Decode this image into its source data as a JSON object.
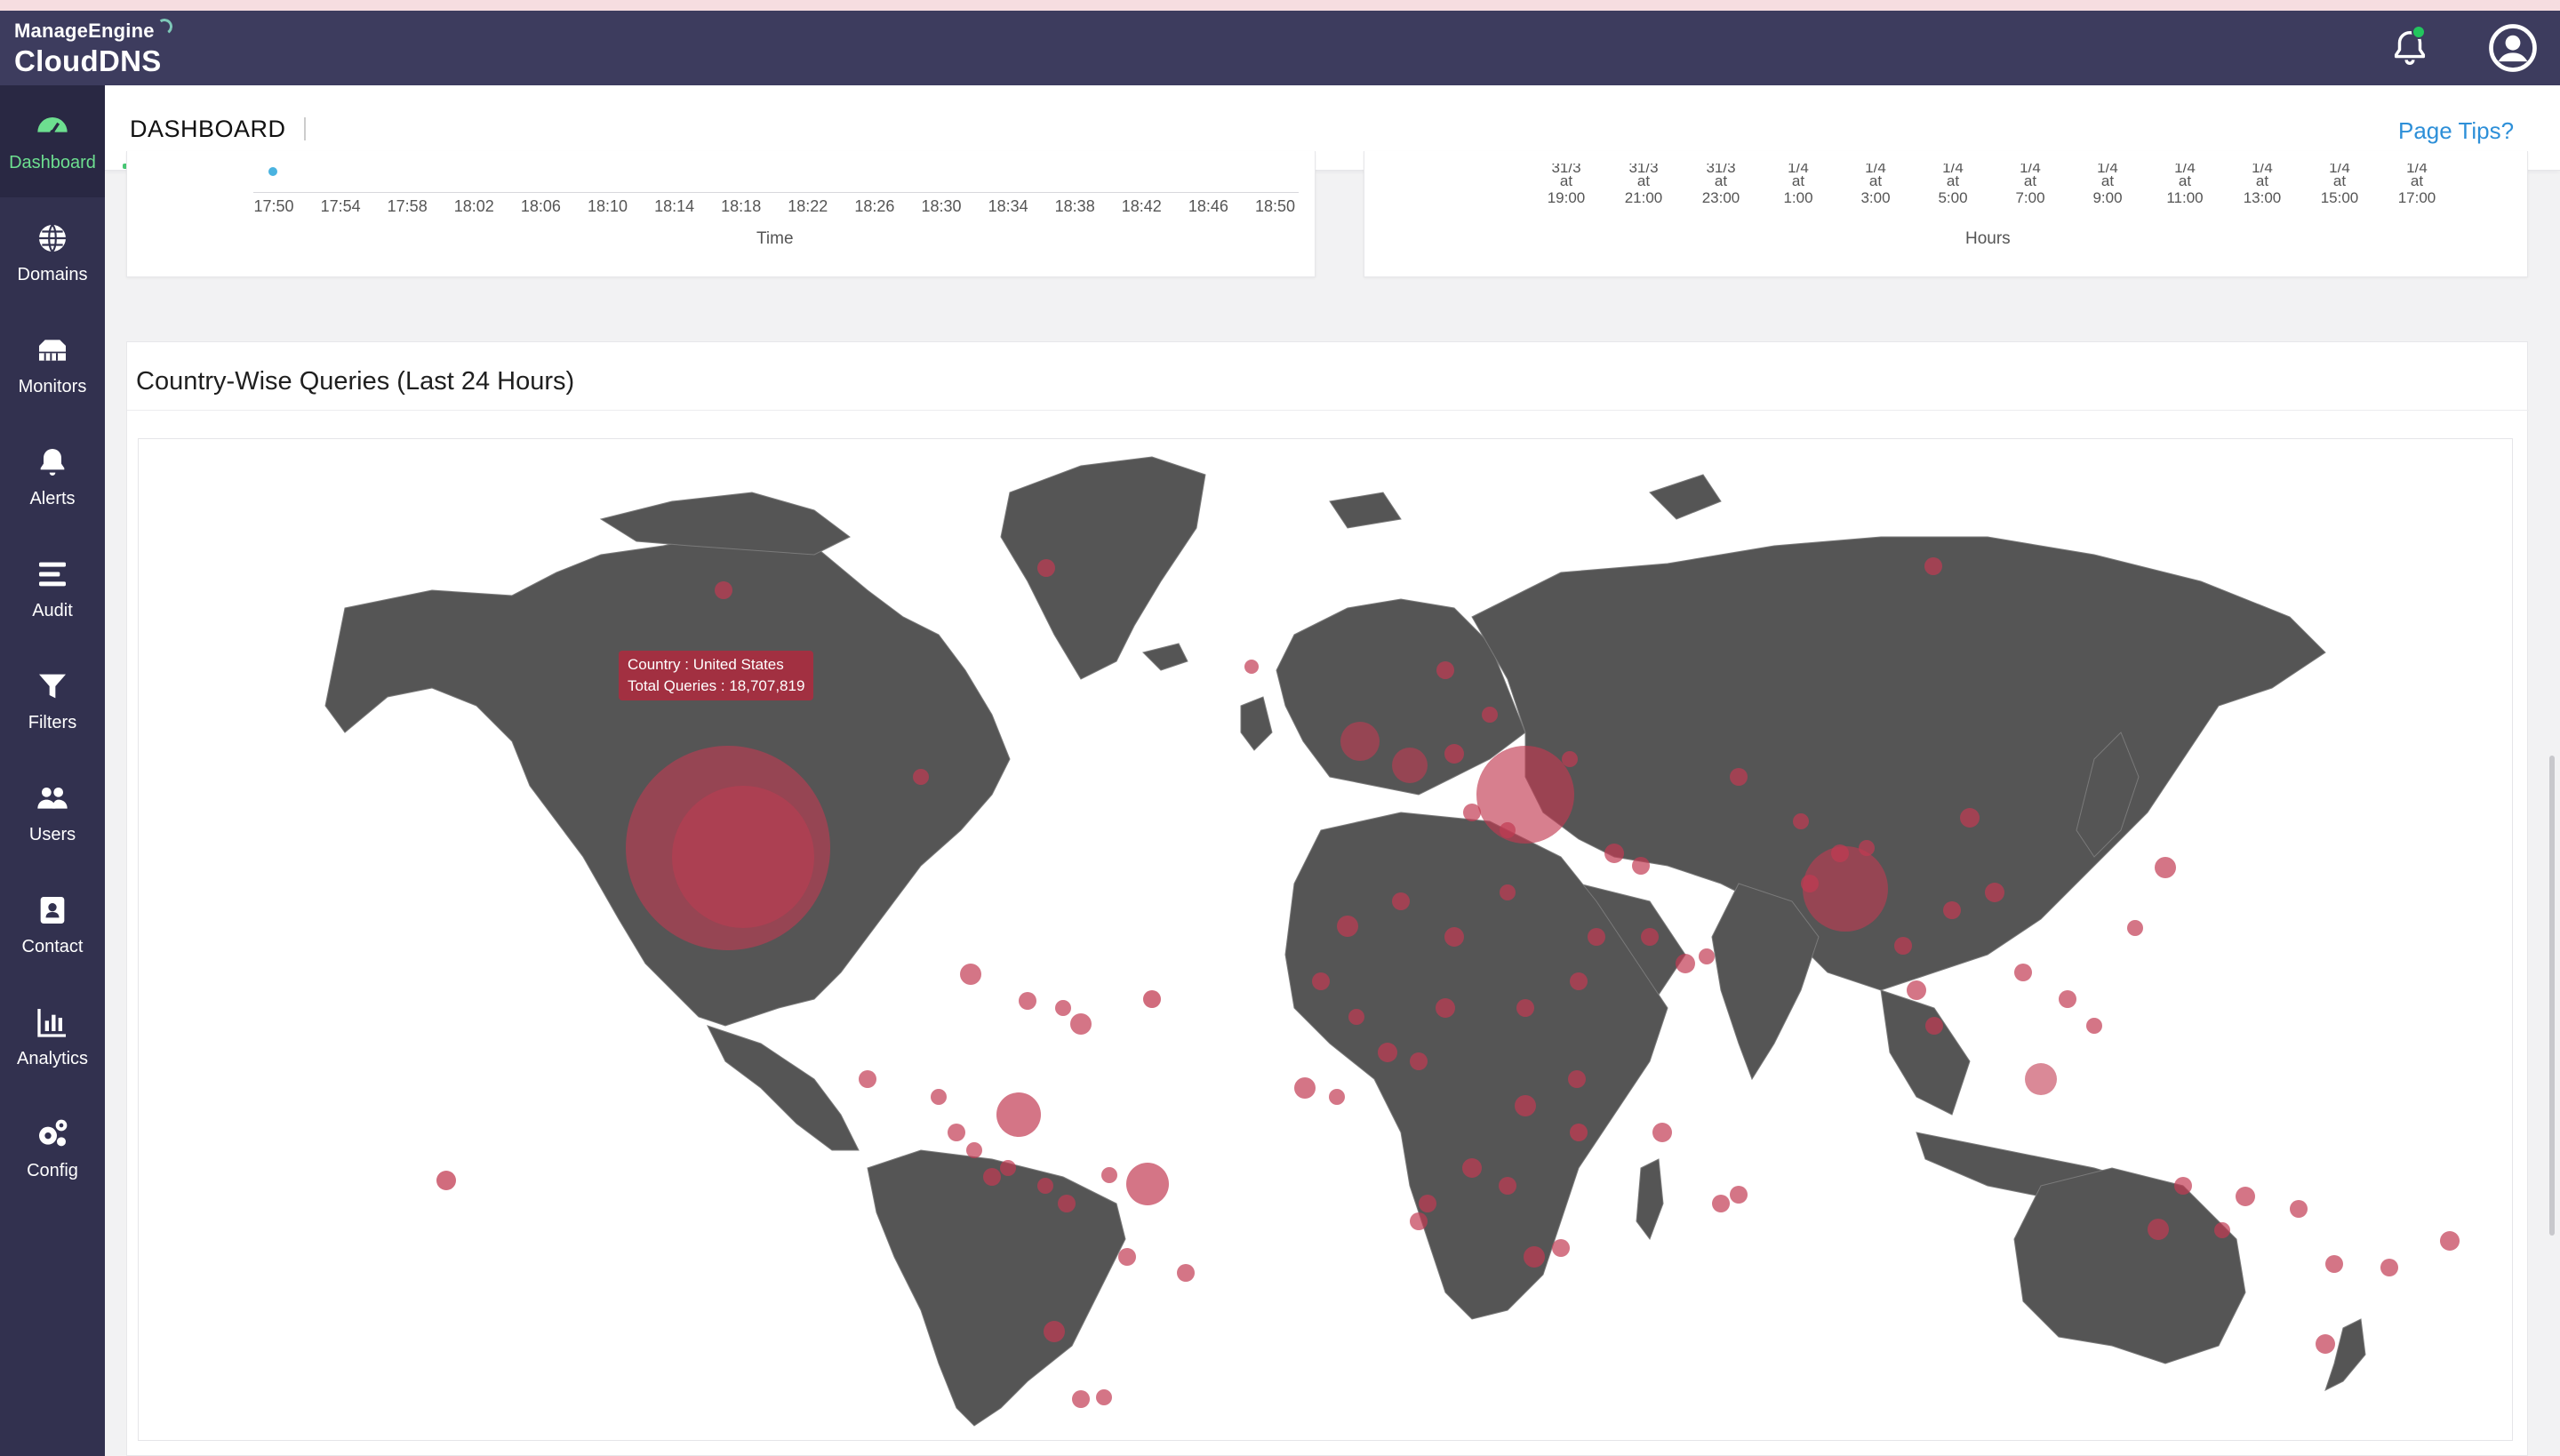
{
  "app": {
    "brand_top": "ManageEngine",
    "brand_bottom": "CloudDNS"
  },
  "sidebar": {
    "items": [
      {
        "label": "Dashboard",
        "icon": "speedometer-icon"
      },
      {
        "label": "Domains",
        "icon": "globe-icon"
      },
      {
        "label": "Monitors",
        "icon": "network-icon"
      },
      {
        "label": "Alerts",
        "icon": "bell-icon"
      },
      {
        "label": "Audit",
        "icon": "list-icon"
      },
      {
        "label": "Filters",
        "icon": "funnel-icon"
      },
      {
        "label": "Users",
        "icon": "users-icon"
      },
      {
        "label": "Contact",
        "icon": "contact-icon"
      },
      {
        "label": "Analytics",
        "icon": "bar-chart-icon"
      },
      {
        "label": "Config",
        "icon": "gears-icon"
      }
    ]
  },
  "header": {
    "tab": "DASHBOARD",
    "page_tips": "Page Tips?"
  },
  "chart_left": {
    "ticks": [
      "17:50",
      "17:54",
      "17:58",
      "18:02",
      "18:06",
      "18:10",
      "18:14",
      "18:18",
      "18:22",
      "18:26",
      "18:30",
      "18:34",
      "18:38",
      "18:42",
      "18:46",
      "18:50"
    ],
    "xlabel": "Time"
  },
  "chart_right": {
    "ticks": [
      {
        "d": "31/3",
        "t": "19:00"
      },
      {
        "d": "31/3",
        "t": "21:00"
      },
      {
        "d": "31/3",
        "t": "23:00"
      },
      {
        "d": "1/4",
        "t": "1:00"
      },
      {
        "d": "1/4",
        "t": "3:00"
      },
      {
        "d": "1/4",
        "t": "5:00"
      },
      {
        "d": "1/4",
        "t": "7:00"
      },
      {
        "d": "1/4",
        "t": "9:00"
      },
      {
        "d": "1/4",
        "t": "11:00"
      },
      {
        "d": "1/4",
        "t": "13:00"
      },
      {
        "d": "1/4",
        "t": "15:00"
      },
      {
        "d": "1/4",
        "t": "17:00"
      }
    ],
    "at": "at",
    "xlabel": "Hours"
  },
  "map": {
    "title": "Country-Wise Queries (Last 24 Hours)",
    "tooltip_country": "Country : United States",
    "tooltip_queries": "Total Queries : 18,707,819"
  },
  "colors": {
    "topbar": "#3d3c5e",
    "sidebar": "#32314f",
    "active_label": "#6ddf90",
    "land": "#555555",
    "bubble": "#c23b52",
    "link": "#2d8fd8"
  }
}
